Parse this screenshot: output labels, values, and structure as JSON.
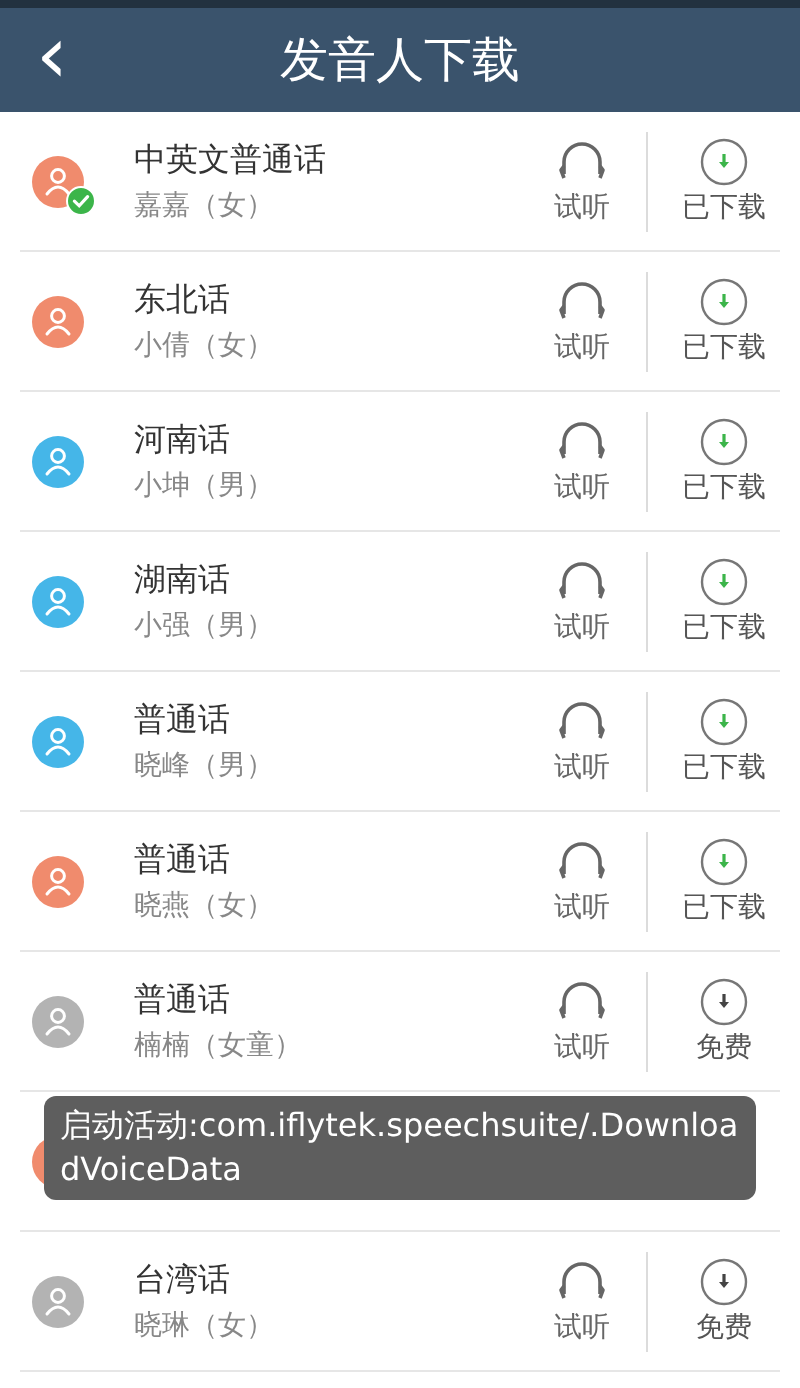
{
  "header": {
    "title": "发音人下载",
    "back": "‹"
  },
  "speakers": [
    {
      "dialect": "中英文普通话",
      "voice": "嘉嘉（女）",
      "color": "#f08b6d",
      "in_use": true,
      "listen": "试听",
      "downloaded": true,
      "action": "已下载"
    },
    {
      "dialect": "东北话",
      "voice": "小倩（女）",
      "color": "#f08b6d",
      "in_use": false,
      "listen": "试听",
      "downloaded": true,
      "action": "已下载"
    },
    {
      "dialect": "河南话",
      "voice": "小坤（男）",
      "color": "#45b6e8",
      "in_use": false,
      "listen": "试听",
      "downloaded": true,
      "action": "已下载"
    },
    {
      "dialect": "湖南话",
      "voice": "小强（男）",
      "color": "#45b6e8",
      "in_use": false,
      "listen": "试听",
      "downloaded": true,
      "action": "已下载"
    },
    {
      "dialect": "普通话",
      "voice": "晓峰（男）",
      "color": "#45b6e8",
      "in_use": false,
      "listen": "试听",
      "downloaded": true,
      "action": "已下载"
    },
    {
      "dialect": "普通话",
      "voice": "晓燕（女）",
      "color": "#f08b6d",
      "in_use": false,
      "listen": "试听",
      "downloaded": true,
      "action": "已下载"
    },
    {
      "dialect": "普通话",
      "voice": "楠楠（女童）",
      "color": "#b3b3b3",
      "in_use": false,
      "listen": "试听",
      "downloaded": false,
      "action": "免费"
    },
    {
      "color": "#f08b6d"
    },
    {
      "dialect": "台湾话",
      "voice": "晓琳（女）",
      "color": "#b3b3b3",
      "in_use": false,
      "listen": "试听",
      "downloaded": false,
      "action": "免费"
    }
  ],
  "toast": {
    "text": "启动活动:com.iflytek.speechsuite/.DownloadVoiceData"
  }
}
